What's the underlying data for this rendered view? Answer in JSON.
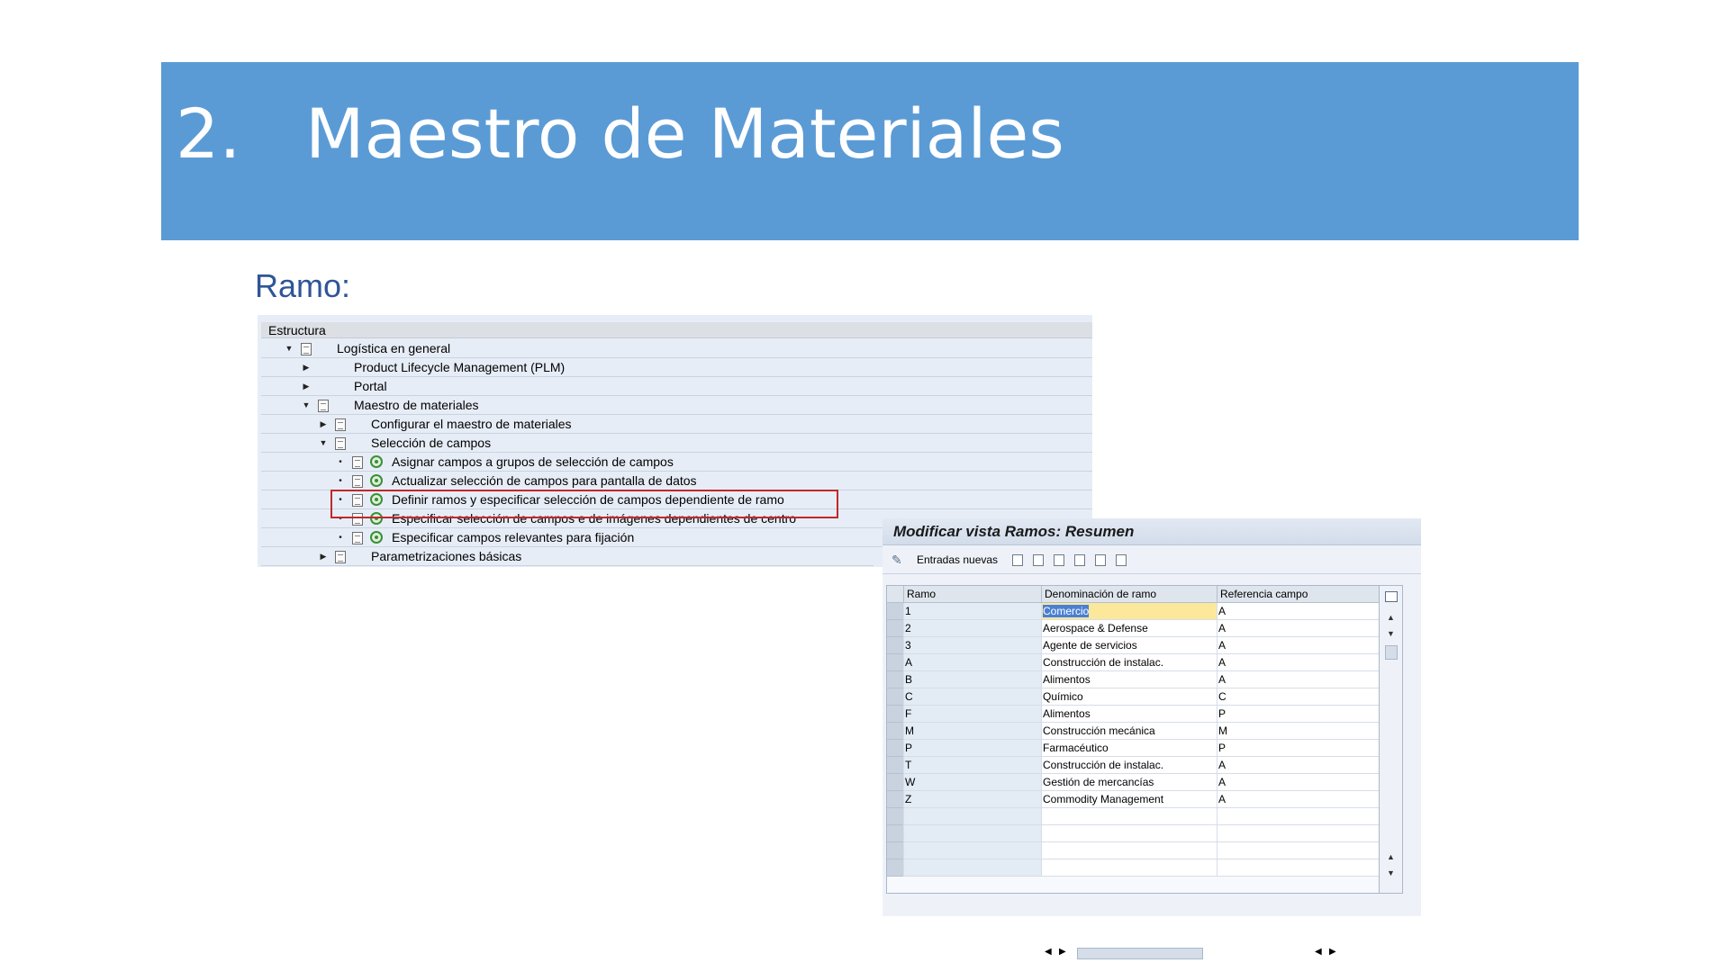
{
  "slide": {
    "number": "2.",
    "title": "Maestro de Materiales",
    "subtitle": "Ramo:"
  },
  "tree": {
    "header": "Estructura",
    "items": [
      {
        "label": "Logística en general",
        "level": 0,
        "expander": "expanded",
        "icons": [
          "doc"
        ]
      },
      {
        "label": "Product Lifecycle Management (PLM)",
        "level": 1,
        "expander": "collapsed",
        "icons": []
      },
      {
        "label": "Portal",
        "level": 1,
        "expander": "collapsed",
        "icons": []
      },
      {
        "label": "Maestro de materiales",
        "level": 1,
        "expander": "expanded",
        "icons": [
          "doc"
        ]
      },
      {
        "label": "Configurar el maestro de materiales",
        "level": 2,
        "expander": "collapsed",
        "icons": [
          "doc"
        ]
      },
      {
        "label": "Selección de campos",
        "level": 2,
        "expander": "expanded",
        "icons": [
          "doc"
        ]
      },
      {
        "label": "Asignar campos a grupos de selección de campos",
        "level": 3,
        "expander": "leaf",
        "icons": [
          "doc",
          "execute"
        ]
      },
      {
        "label": "Actualizar selección de campos para pantalla de datos",
        "level": 3,
        "expander": "leaf",
        "icons": [
          "doc",
          "execute"
        ]
      },
      {
        "label": "Definir ramos y especificar selección de campos dependiente de ramo",
        "level": 3,
        "expander": "leaf",
        "icons": [
          "doc",
          "execute"
        ]
      },
      {
        "label": "Especificar selección de campos e de imágenes dependientes de centro",
        "level": 3,
        "expander": "leaf",
        "icons": [
          "doc",
          "execute"
        ]
      },
      {
        "label": "Especificar campos relevantes para fijación",
        "level": 3,
        "expander": "leaf",
        "icons": [
          "doc",
          "execute"
        ]
      },
      {
        "label": "Parametrizaciones básicas",
        "level": 2,
        "expander": "collapsed",
        "icons": [
          "doc"
        ]
      }
    ]
  },
  "window": {
    "title": "Modificar vista Ramos: Resumen",
    "toolbar": {
      "new_entries_label": "Entradas nuevas",
      "icons": [
        "copy-icon",
        "delete-icon",
        "undo-icon",
        "select-all-icon",
        "select-block-icon",
        "deselect-all-icon"
      ]
    },
    "columns": [
      "Ramo",
      "Denominación de ramo",
      "Referencia campo"
    ],
    "rows": [
      [
        "1",
        "Comercio",
        "A"
      ],
      [
        "2",
        "Aerospace & Defense",
        "A"
      ],
      [
        "3",
        "Agente de servicios",
        "A"
      ],
      [
        "A",
        "Construcción de instalac.",
        "A"
      ],
      [
        "B",
        "Alimentos",
        "A"
      ],
      [
        "C",
        "Químico",
        "C"
      ],
      [
        "F",
        "Alimentos",
        "P"
      ],
      [
        "M",
        "Construcción mecánica",
        "M"
      ],
      [
        "P",
        "Farmacéutico",
        "P"
      ],
      [
        "T",
        "Construcción de instalac.",
        "A"
      ],
      [
        "W",
        "Gestión de mercancías",
        "A"
      ],
      [
        "Z",
        "Commodity Management",
        "A"
      ]
    ],
    "empty_rows": 4,
    "active_cell": {
      "row": 0,
      "col": 1
    }
  },
  "colors": {
    "banner": "#5b9bd5",
    "subtitle": "#2f5597",
    "highlight_border": "#c0282d"
  }
}
